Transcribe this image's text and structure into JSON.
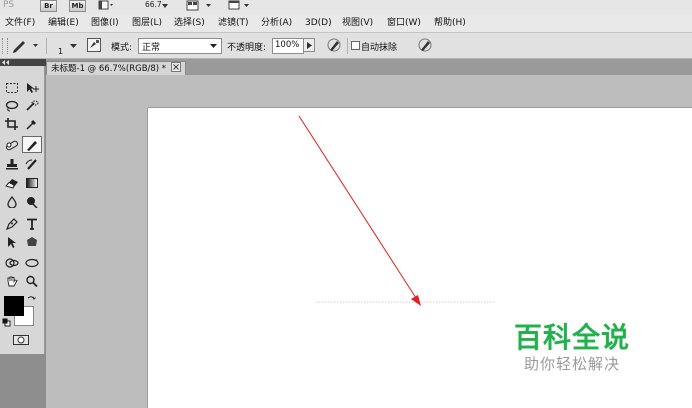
{
  "titlebar": {
    "logo": "PS",
    "bridge": "Br",
    "minibridge": "Mb",
    "zoom": "66.7"
  },
  "menu": [
    {
      "label": "文件(F)"
    },
    {
      "label": "编辑(E)"
    },
    {
      "label": "图像(I)"
    },
    {
      "label": "图层(L)"
    },
    {
      "label": "选择(S)"
    },
    {
      "label": "滤镜(T)"
    },
    {
      "label": "分析(A)"
    },
    {
      "label": "3D(D)"
    },
    {
      "label": "视图(V)"
    },
    {
      "label": "窗口(W)"
    },
    {
      "label": "帮助(H)"
    }
  ],
  "options": {
    "brush_size": "1",
    "mode_label": "模式:",
    "mode_value": "正常",
    "opacity_label": "不透明度:",
    "opacity_value": "100%",
    "auto_erase_label": "自动抹除"
  },
  "document": {
    "tab_title": "未标题-1 @ 66.7%(RGB/8) *"
  },
  "watermark": {
    "title": "百科全说",
    "subtitle": "助你轻松解决"
  },
  "colors": {
    "foreground": "#000000",
    "background": "#ffffff",
    "annotation_arrow": "#e02020",
    "watermark_green": "#22b14c"
  }
}
